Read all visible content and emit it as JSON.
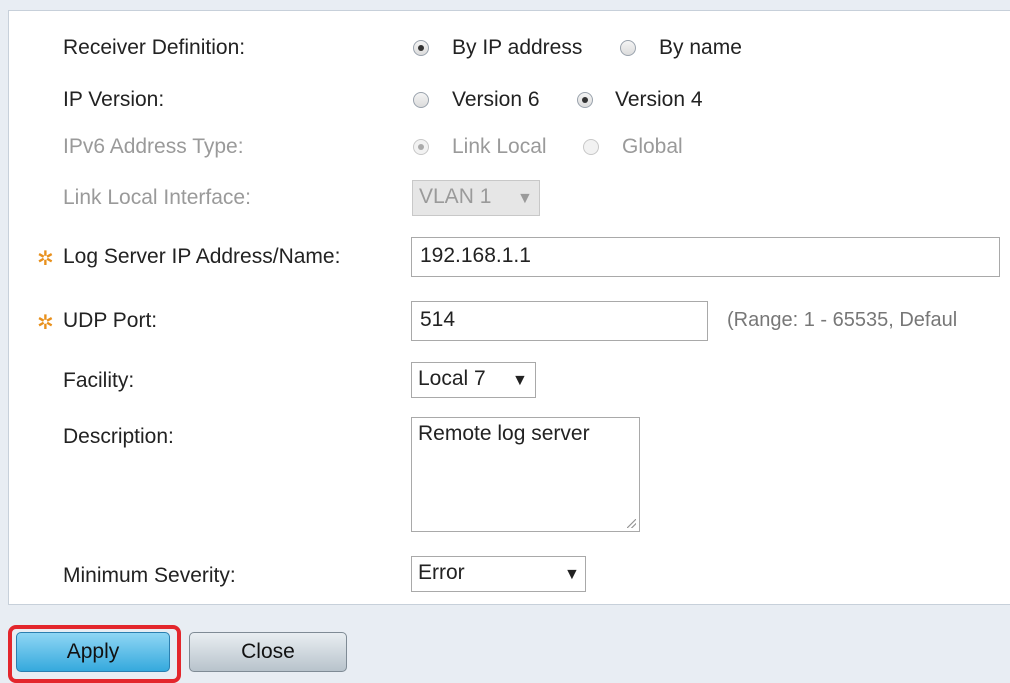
{
  "form": {
    "receiver_definition": {
      "label": "Receiver Definition:",
      "options": [
        {
          "label": "By IP address",
          "selected": true
        },
        {
          "label": "By name",
          "selected": false
        }
      ]
    },
    "ip_version": {
      "label": "IP Version:",
      "options": [
        {
          "label": "Version 6",
          "selected": false
        },
        {
          "label": "Version 4",
          "selected": true
        }
      ]
    },
    "ipv6_address_type": {
      "label": "IPv6 Address Type:",
      "disabled": true,
      "options": [
        {
          "label": "Link Local",
          "selected": true
        },
        {
          "label": "Global",
          "selected": false
        }
      ]
    },
    "link_local_interface": {
      "label": "Link Local Interface:",
      "disabled": true,
      "value": "VLAN 1"
    },
    "log_server": {
      "label": "Log Server IP Address/Name:",
      "value": "192.168.1.1",
      "required": true
    },
    "udp_port": {
      "label": "UDP Port:",
      "value": "514",
      "hint": "(Range: 1 - 65535, Defaul",
      "required": true
    },
    "facility": {
      "label": "Facility:",
      "value": "Local 7"
    },
    "description": {
      "label": "Description:",
      "value": "Remote log server"
    },
    "minimum_severity": {
      "label": "Minimum Severity:",
      "value": "Error"
    },
    "required_icon": "gear-icon"
  },
  "buttons": {
    "apply": "Apply",
    "close": "Close"
  },
  "colors": {
    "required": "#e8901c",
    "highlight": "#e3262c",
    "apply_button": "#35a9dd"
  }
}
